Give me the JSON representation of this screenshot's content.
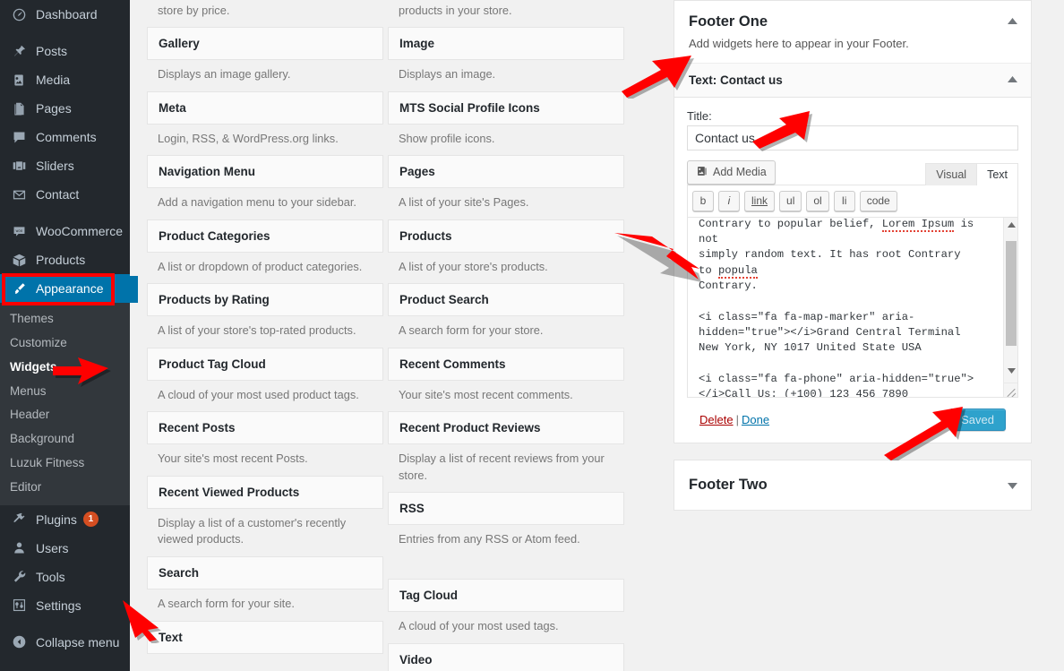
{
  "sidebar": {
    "items": [
      {
        "label": "Dashboard",
        "icon": "dashboard-icon"
      },
      {
        "label": "Posts",
        "icon": "pin-icon"
      },
      {
        "label": "Media",
        "icon": "media-icon"
      },
      {
        "label": "Pages",
        "icon": "pages-icon"
      },
      {
        "label": "Comments",
        "icon": "comments-icon"
      },
      {
        "label": "Sliders",
        "icon": "sliders-icon"
      },
      {
        "label": "Contact",
        "icon": "envelope-icon"
      },
      {
        "label": "WooCommerce",
        "icon": "woo-icon"
      },
      {
        "label": "Products",
        "icon": "box-icon"
      },
      {
        "label": "Appearance",
        "icon": "brush-icon"
      },
      {
        "label": "Plugins",
        "icon": "plugin-icon",
        "badge": "1"
      },
      {
        "label": "Users",
        "icon": "user-icon"
      },
      {
        "label": "Tools",
        "icon": "wrench-icon"
      },
      {
        "label": "Settings",
        "icon": "settings-icon"
      },
      {
        "label": "Collapse menu",
        "icon": "collapse-icon"
      }
    ],
    "appearance_submenu": [
      {
        "label": "Themes",
        "active": false
      },
      {
        "label": "Customize",
        "active": false
      },
      {
        "label": "Widgets",
        "active": true
      },
      {
        "label": "Menus",
        "active": false
      },
      {
        "label": "Header",
        "active": false
      },
      {
        "label": "Background",
        "active": false
      },
      {
        "label": "Luzuk Fitness",
        "active": false
      },
      {
        "label": "Editor",
        "active": false
      }
    ]
  },
  "available_widgets": {
    "column1": [
      {
        "name": "",
        "desc": "Display a slider to filter products in your store by price.",
        "partial": true
      },
      {
        "name": "Gallery",
        "desc": "Displays an image gallery."
      },
      {
        "name": "Meta",
        "desc": "Login, RSS, & WordPress.org links."
      },
      {
        "name": "Navigation Menu",
        "desc": "Add a navigation menu to your sidebar."
      },
      {
        "name": "Product Categories",
        "desc": "A list or dropdown of product categories."
      },
      {
        "name": "Products by Rating",
        "desc": "A list of your store's top-rated products."
      },
      {
        "name": "Product Tag Cloud",
        "desc": "A cloud of your most used product tags."
      },
      {
        "name": "Recent Posts",
        "desc": "Your site's most recent Posts."
      },
      {
        "name": "Recent Viewed Products",
        "desc": "Display a list of a customer's recently viewed products."
      },
      {
        "name": "Search",
        "desc": "A search form for your site."
      },
      {
        "name": "Text",
        "desc": ""
      }
    ],
    "column2": [
      {
        "name": "",
        "desc": "Display a list of star ratings to filter products in your store.",
        "partial": true
      },
      {
        "name": "Image",
        "desc": "Displays an image."
      },
      {
        "name": "MTS Social Profile Icons",
        "desc": "Show profile icons."
      },
      {
        "name": "Pages",
        "desc": "A list of your site's Pages."
      },
      {
        "name": "Products",
        "desc": "A list of your store's products."
      },
      {
        "name": "Product Search",
        "desc": "A search form for your store."
      },
      {
        "name": "Recent Comments",
        "desc": "Your site's most recent comments."
      },
      {
        "name": "Recent Product Reviews",
        "desc": "Display a list of recent reviews from your store."
      },
      {
        "name": "RSS",
        "desc": "Entries from any RSS or Atom feed."
      },
      {
        "name": "Tag Cloud",
        "desc": "A cloud of your most used tags."
      },
      {
        "name": "Video",
        "desc": ""
      }
    ]
  },
  "widget_areas": {
    "footer_one": {
      "title": "Footer One",
      "description": "Add widgets here to appear in your Footer.",
      "toggle": "collapse",
      "widget": {
        "header": "Text: Contact us",
        "toggle": "collapse",
        "title_label": "Title:",
        "title_value": "Contact us",
        "add_media_label": "Add Media",
        "tabs": [
          {
            "label": "Visual",
            "active": false
          },
          {
            "label": "Text",
            "active": true
          }
        ],
        "quicktags": [
          "b",
          "i",
          "link",
          "ul",
          "ol",
          "li",
          "code"
        ],
        "content_line_1": "Contrary to popular belief, ",
        "content_lorem": "Lorem Ipsum",
        "content_line_1b": " is not",
        "content_line_2": "simply random text. It has root Contrary to ",
        "content_popula": "popula",
        "content_line_3": "Contrary.",
        "content_rest": "<i class=\"fa fa-map-marker\" aria-hidden=\"true\"></i>Grand Central Terminal New York, NY 1017 United State USA\n\n<i class=\"fa fa-phone\" aria-hidden=\"true\"></i>Call Us: (+100) 123 456 7890\n\n<i class=\"fa fa-envelope-o\" aria-hidden=\"true\"></i>Email Us: support@sitename.com",
        "delete_label": "Delete",
        "separator": "|",
        "done_label": "Done",
        "save_label": "Saved"
      }
    },
    "footer_two": {
      "title": "Footer Two",
      "toggle": "expand"
    }
  },
  "colors": {
    "admin_bg": "#23282d",
    "submenu_bg": "#32373c",
    "highlight_blue": "#0073aa",
    "button_blue": "#2ea2cc",
    "annotation_red": "#ff0000",
    "badge_orange": "#d54e21"
  }
}
